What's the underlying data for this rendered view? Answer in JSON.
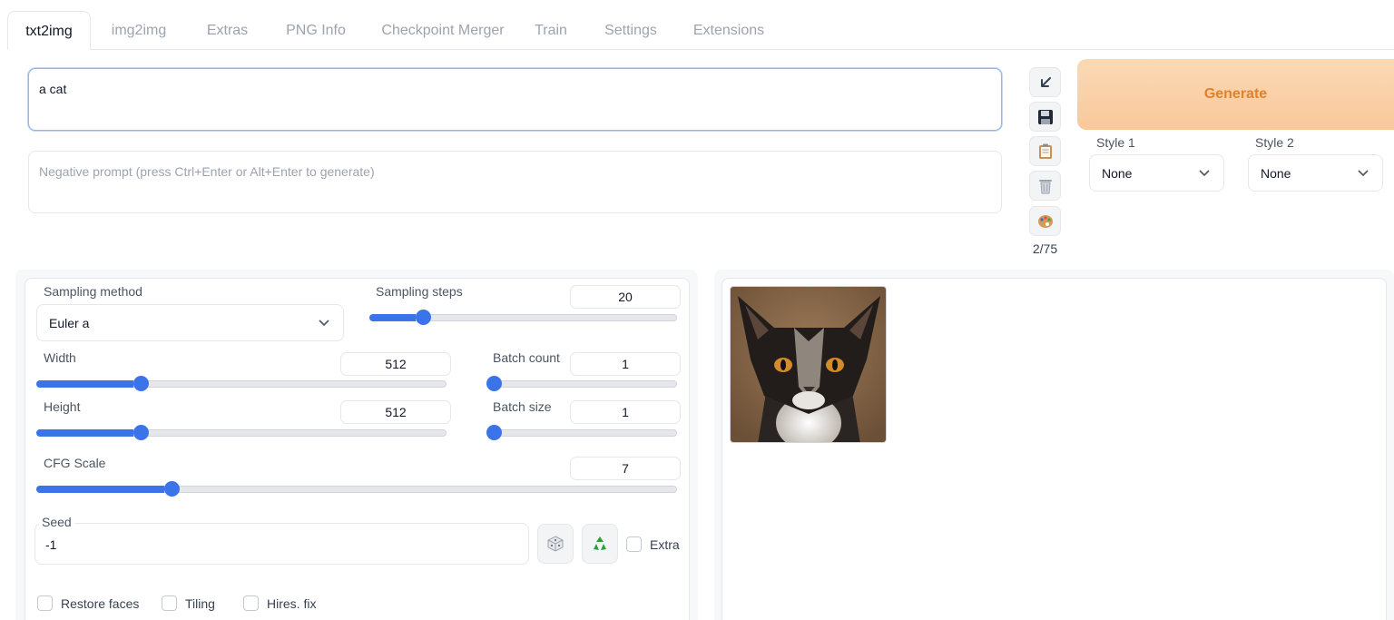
{
  "tabs": [
    {
      "label": "txt2img",
      "active": true
    },
    {
      "label": "img2img",
      "active": false
    },
    {
      "label": "Extras",
      "active": false
    },
    {
      "label": "PNG Info",
      "active": false
    },
    {
      "label": "Checkpoint Merger",
      "active": false
    },
    {
      "label": "Train",
      "active": false
    },
    {
      "label": "Settings",
      "active": false
    },
    {
      "label": "Extensions",
      "active": false
    }
  ],
  "prompt": {
    "value": "a cat"
  },
  "negative_prompt": {
    "value": "",
    "placeholder": "Negative prompt (press Ctrl+Enter or Alt+Enter to generate)"
  },
  "tools": {
    "icons": [
      "arrow-down-left-icon",
      "save-icon",
      "clipboard-icon",
      "trash-icon",
      "palette-icon"
    ],
    "token_count": "2/75"
  },
  "generate": {
    "label": "Generate",
    "color": "#e2812a"
  },
  "styles": {
    "style1": {
      "label": "Style 1",
      "value": "None"
    },
    "style2": {
      "label": "Style 2",
      "value": "None"
    }
  },
  "params": {
    "sampling_method": {
      "label": "Sampling method",
      "value": "Euler a"
    },
    "sampling_steps": {
      "label": "Sampling steps",
      "value": "20",
      "fraction": 0.15
    },
    "width": {
      "label": "Width",
      "value": "512",
      "fraction": 0.237
    },
    "height": {
      "label": "Height",
      "value": "512",
      "fraction": 0.237
    },
    "batch_count": {
      "label": "Batch count",
      "value": "1",
      "fraction": 0.0
    },
    "batch_size": {
      "label": "Batch size",
      "value": "1",
      "fraction": 0.0
    },
    "cfg_scale": {
      "label": "CFG Scale",
      "value": "7",
      "fraction": 0.2
    }
  },
  "seed": {
    "label": "Seed",
    "value": "-1",
    "extra_label": "Extra",
    "extra_checked": false
  },
  "checkboxes": [
    {
      "label": "Restore faces",
      "checked": false
    },
    {
      "label": "Tiling",
      "checked": false
    },
    {
      "label": "Hires. fix",
      "checked": false
    }
  ],
  "accent_color": "#3b73e8"
}
